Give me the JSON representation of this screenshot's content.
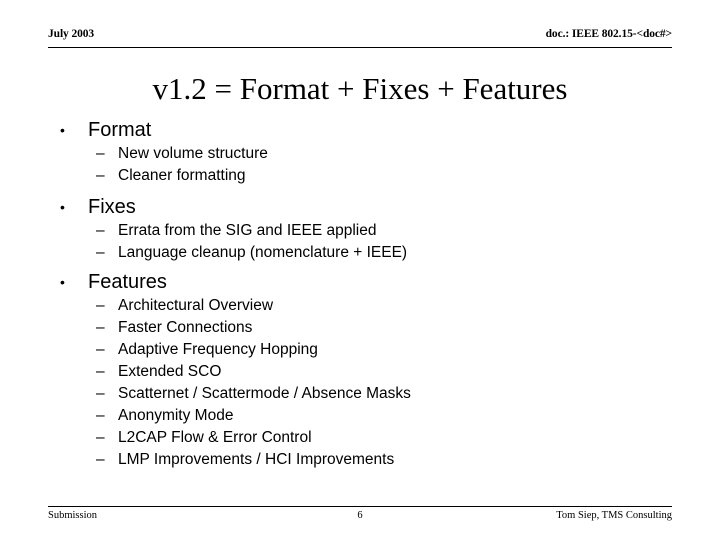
{
  "header": {
    "left": "July 2003",
    "right": "doc.: IEEE 802.15-<doc#>"
  },
  "title": "v1.2 = Format + Fixes + Features",
  "bullet_marker": "•",
  "dash_marker": "–",
  "sections": [
    {
      "heading": "Format",
      "items": [
        "New volume structure",
        "Cleaner formatting"
      ]
    },
    {
      "heading": "Fixes",
      "items": [
        "Errata from the SIG and IEEE applied",
        "Language cleanup (nomenclature + IEEE)"
      ]
    },
    {
      "heading": "Features",
      "items": [
        "Architectural Overview",
        "Faster Connections",
        "Adaptive Frequency Hopping",
        "Extended SCO",
        "Scatternet / Scattermode / Absence Masks",
        "Anonymity Mode",
        "L2CAP Flow & Error Control",
        "LMP Improvements / HCI Improvements"
      ]
    }
  ],
  "footer": {
    "left": "Submission",
    "page": "6",
    "right": "Tom Siep, TMS Consulting"
  }
}
